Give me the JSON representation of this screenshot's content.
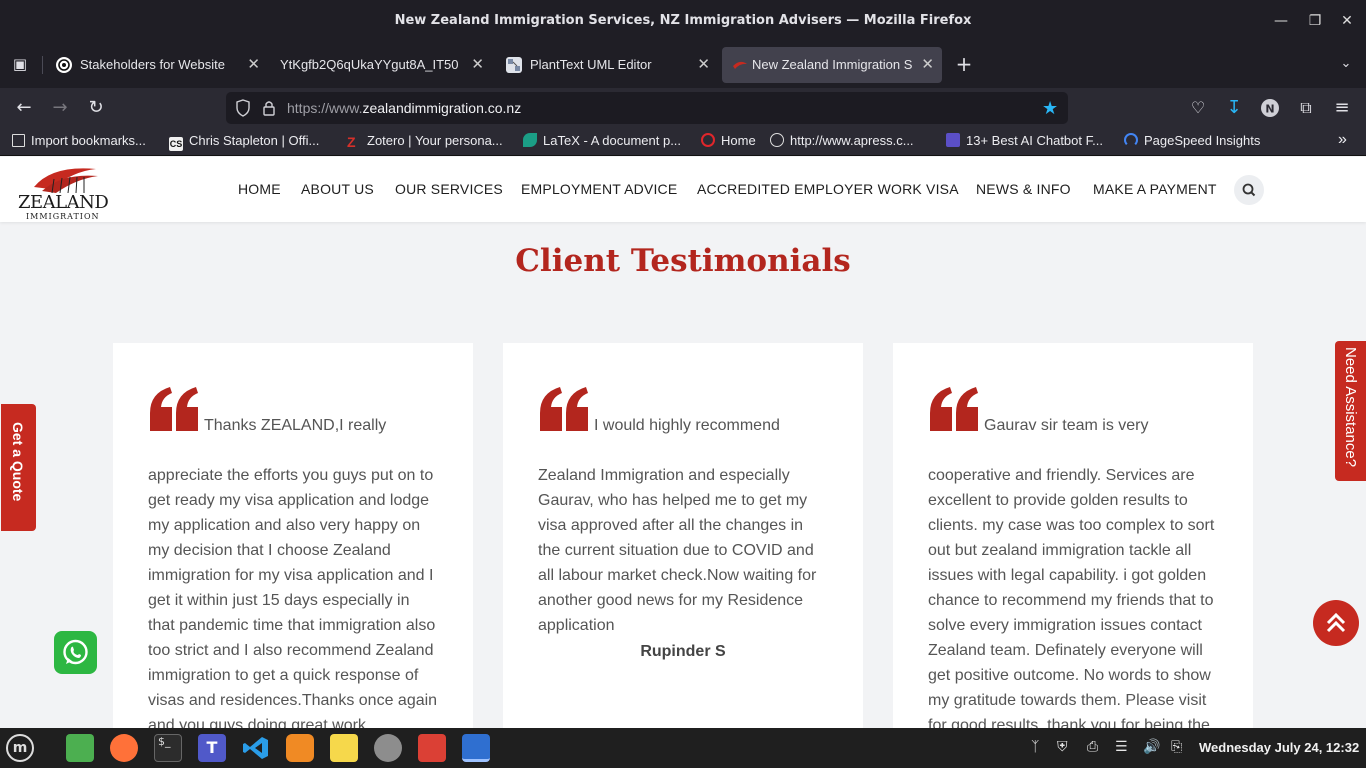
{
  "window": {
    "title": "New Zealand Immigration Services, NZ Immigration Advisers — Mozilla Firefox"
  },
  "tabs": [
    {
      "label": "Stakeholders for Website",
      "icon": "chatgpt-icon"
    },
    {
      "label": "YtKgfb2Q6qUkaYYgut8A_IT50",
      "icon": "document-icon"
    },
    {
      "label": "PlantText UML Editor",
      "icon": "planttext-icon"
    },
    {
      "label": "New Zealand Immigration S",
      "icon": "nz-immigration-icon",
      "active": true
    }
  ],
  "navbar": {
    "url_prefix": "https://www.",
    "url_domain": "zealandimmigration.co.nz"
  },
  "bookmarks": [
    {
      "label": "Import bookmarks...",
      "icon": "import-icon"
    },
    {
      "label": "Chris Stapleton | Offi...",
      "icon": "cs-icon"
    },
    {
      "label": "Zotero | Your persona...",
      "icon": "zotero-icon"
    },
    {
      "label": "LaTeX - A document p...",
      "icon": "latex-icon"
    },
    {
      "label": "Home",
      "icon": "home-site-icon"
    },
    {
      "label": "http://www.apress.c...",
      "icon": "globe-icon"
    },
    {
      "label": "13+ Best AI Chatbot F...",
      "icon": "chatbot-icon"
    },
    {
      "label": "PageSpeed Insights",
      "icon": "pagespeed-icon"
    }
  ],
  "site": {
    "logo_main": "ZEALAND",
    "logo_sub": "IMMIGRATION",
    "menu": [
      "HOME",
      "ABOUT US",
      "OUR SERVICES",
      "EMPLOYMENT ADVICE",
      "ACCREDITED EMPLOYER WORK VISA",
      "NEWS & INFO",
      "MAKE A PAYMENT"
    ],
    "section_title": "Client Testimonials",
    "testimonials": [
      {
        "first_line": "Thanks ZEALAND,I really",
        "body": [
          "appreciate the efforts you guys put on to",
          "get ready my visa application and lodge",
          "my application and also very happy on",
          "my decision that I choose Zealand",
          "immigration for my visa application and I",
          "get it within just 15 days especially in",
          "that pandemic time that immigration also",
          "too strict and I also recommend Zealand",
          "immigration to get a quick response of",
          "visas and residences.Thanks once again",
          "and you guys doing great work"
        ],
        "author": ""
      },
      {
        "first_line": "I would highly recommend",
        "body": [
          "Zealand Immigration and especially",
          "Gaurav, who has helped me to get my",
          "visa approved after all the changes in",
          "the current situation due to COVID and",
          "all labour market check.Now waiting for",
          "another good news for my Residence",
          "application"
        ],
        "author": "Rupinder S"
      },
      {
        "first_line": "Gaurav sir team is very",
        "body": [
          "cooperative and friendly. Services are",
          "excellent to provide golden results to",
          "clients. my case was too complex to sort",
          "out but zealand immigration tackle all",
          "issues with legal capability. i got golden",
          "chance to recommend my friends that to",
          "solve every immigration issues contact",
          "Zealand team. Definately everyone will",
          "get positive outcome. No words to show",
          "my gratitude towards them. Please visit",
          "for good results. thank you for being the"
        ],
        "author": ""
      }
    ],
    "get_quote": "Get a Quote",
    "need_assistance": "Need Assistance?",
    "brand_red": "#c62a20"
  },
  "taskbar": {
    "clock": "Wednesday July 24, 12:32"
  }
}
